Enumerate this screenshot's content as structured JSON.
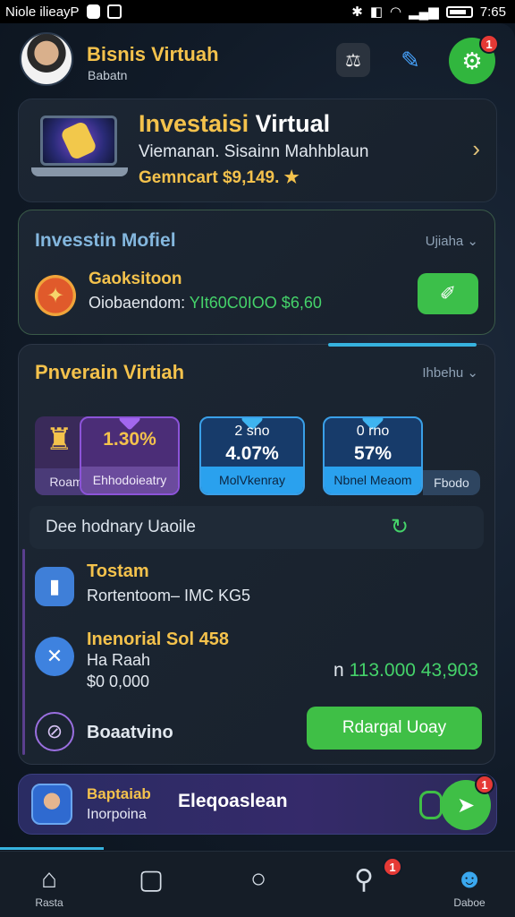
{
  "status_bar": {
    "left_text": "Niole ilieayP",
    "time": "7:65"
  },
  "header": {
    "title": "Bisnis Virtuah",
    "subtitle": "Babatn",
    "notification_count": "1",
    "icons": [
      "scale-icon",
      "pen-icon",
      "gear-icon"
    ]
  },
  "promo": {
    "title_colored": "Investaisi",
    "title_white": "Virtual",
    "subtitle": "Viemanan. Sisainn Mahhblaun",
    "meta": "Gemncart $9,149. ★"
  },
  "model": {
    "title": "Invesstin Mofiel",
    "dropdown": "Ujiaha ⌄",
    "item_name": "Gaoksitoon",
    "item_line_prefix": "Oiobaendom:",
    "item_line_value": "YIt60C0IOO $6,60"
  },
  "panel": {
    "title": "Pnverain Virtiah",
    "dropdown": "Ihbehu ⌄",
    "tiles": [
      {
        "label": "Roam"
      },
      {
        "top": "1.30%",
        "label": "Ehhodoieatry"
      },
      {
        "top_small": "2 sno",
        "top": "4.07%",
        "label": "MolVkenray"
      },
      {
        "top_small": "0 rno",
        "top": "57%",
        "label": "Nbnel Meaom"
      },
      {
        "label": "Fbodo"
      }
    ],
    "subheader": "Dee hodnary Uaoile",
    "rows": {
      "row1_title": "Tostam",
      "row1_text": "Rortentoom– IMC KG5",
      "row2_title": "Inenorial Sol 458",
      "row2_line1": "Ha Raah",
      "row2_line2": "$0 0,000",
      "row2_amount_prefix": "n",
      "row2_amount": "113.000 43,903",
      "row3_title": "Boaatvino",
      "cta": "Rdargal Uoay"
    }
  },
  "bottom_card": {
    "title": "Baptaiab",
    "subtitle": "Inorpoina",
    "middle": "Eleqoaslean",
    "notification_count": "1"
  },
  "nav": {
    "items": [
      {
        "label": "Rasta",
        "icon": "home-icon"
      },
      {
        "label": "",
        "icon": "chat-square-icon"
      },
      {
        "label": "",
        "icon": "circle-icon"
      },
      {
        "label": "",
        "icon": "search-bubble-icon",
        "badge": "1"
      },
      {
        "label": "Daboe",
        "icon": "profile-icon"
      }
    ]
  },
  "colors": {
    "accent_gold": "#f4c24c",
    "accent_green": "#3fbf46",
    "accent_blue": "#36b2de",
    "badge_red": "#e53935"
  }
}
